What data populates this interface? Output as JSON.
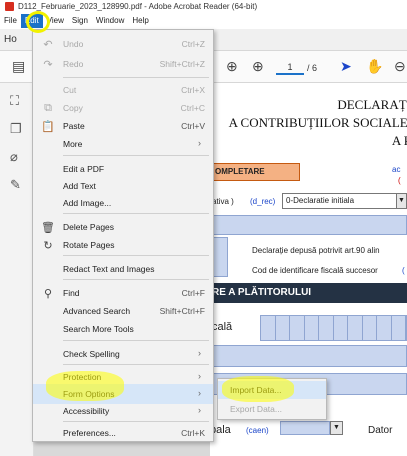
{
  "window": {
    "title": "D112_Februarie_2023_128990.pdf - Adobe Acrobat Reader (64-bit)"
  },
  "menubar": [
    "File",
    "Edit",
    "View",
    "Sign",
    "Window",
    "Help"
  ],
  "tabs": {
    "home": "Ho"
  },
  "toolbar": {
    "page_current": "1",
    "page_total": "/ 6"
  },
  "edit_menu": {
    "undo": {
      "label": "Undo",
      "shortcut": "Ctrl+Z"
    },
    "redo": {
      "label": "Redo",
      "shortcut": "Shift+Ctrl+Z"
    },
    "cut": {
      "label": "Cut",
      "shortcut": "Ctrl+X"
    },
    "copy": {
      "label": "Copy",
      "shortcut": "Ctrl+C"
    },
    "paste": {
      "label": "Paste",
      "shortcut": "Ctrl+V"
    },
    "more": {
      "label": "More"
    },
    "edit_pdf": {
      "label": "Edit a PDF"
    },
    "add_text": {
      "label": "Add Text"
    },
    "add_image": {
      "label": "Add Image..."
    },
    "delete_pages": {
      "label": "Delete Pages"
    },
    "rotate_pages": {
      "label": "Rotate Pages"
    },
    "redact": {
      "label": "Redact Text and Images"
    },
    "find": {
      "label": "Find",
      "shortcut": "Ctrl+F"
    },
    "advanced_search": {
      "label": "Advanced Search",
      "shortcut": "Shift+Ctrl+F"
    },
    "search_more_tools": {
      "label": "Search More Tools"
    },
    "check_spelling": {
      "label": "Check Spelling"
    },
    "protection": {
      "label": "Protection"
    },
    "form_options": {
      "label": "Form Options"
    },
    "accessibility": {
      "label": "Accessibility"
    },
    "preferences": {
      "label": "Preferences...",
      "shortcut": "Ctrl+K"
    }
  },
  "form_options_submenu": {
    "import_data": "Import Data...",
    "export_data": "Export Data..."
  },
  "document": {
    "header_line1": "DECLARAȚI",
    "header_line2": "A CONTRIBUȚIILOR SOCIALE,",
    "header_line3": "A P",
    "completare": "OMPLETARE",
    "rectificativa_label": "ativa )",
    "rectificativa_code": "(d_rec)",
    "declaration_type": "0-Declaratie initiala",
    "side_letter_a": "ac",
    "side_letter_b": "(",
    "depusa_text": "Declarație depusă potrivit art.90 alin",
    "cod_fiscal_text": "Cod de identificare fiscală succesor",
    "cod_fiscal_paren": "(",
    "platitor_heading": "RE A PLĂTITORULUI",
    "fiscala_label": "cală",
    "principala_label": "pala",
    "caen_label": "(caen)",
    "dator_label": "Dator"
  },
  "colors": {
    "accent": "#1b72c9",
    "highlighter": "#f2f200",
    "orange_field": "#f4b183",
    "dark_bar": "#243244"
  }
}
